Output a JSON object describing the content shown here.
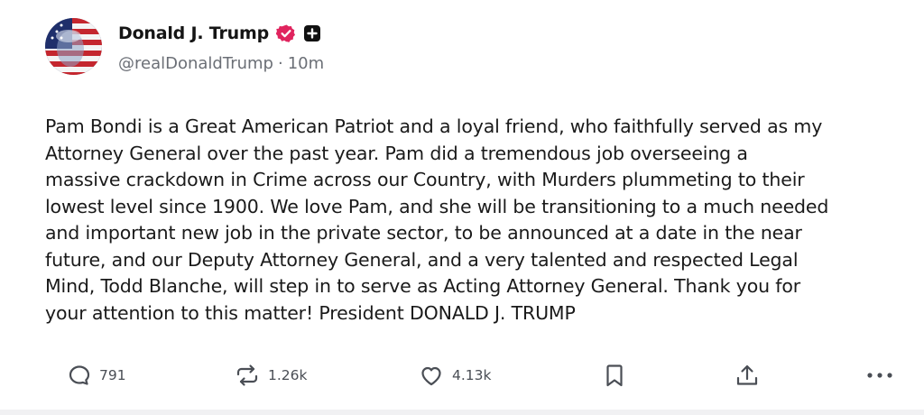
{
  "author": {
    "display_name": "Donald J. Trump",
    "handle": "@realDonaldTrump",
    "separator": "·",
    "time_ago": "10m",
    "verified_color": "#e0245e"
  },
  "post": {
    "text": "Pam Bondi is a Great American Patriot and a loyal friend, who faithfully served as my\nAttorney General over the past year. Pam did a tremendous job overseeing a\nmassive crackdown in Crime across our Country, with Murders plummeting to their\nlowest level since 1900. We love Pam, and she will be transitioning to a much needed\nand important new job in the private sector, to be announced at a date in the near\nfuture, and our Deputy Attorney General, and a very talented and respected Legal\nMind, Todd Blanche, will step in to serve as Acting Attorney General. Thank you for\nyour attention to this matter! President DONALD J. TRUMP"
  },
  "actions": {
    "replies": {
      "icon": "reply-icon",
      "count": "791"
    },
    "retruths": {
      "icon": "repost-icon",
      "count": "1.26k"
    },
    "likes": {
      "icon": "heart-icon",
      "count": "4.13k"
    },
    "bookmark": {
      "icon": "bookmark-icon"
    },
    "share": {
      "icon": "share-icon"
    },
    "more": {
      "icon": "more-icon"
    }
  }
}
